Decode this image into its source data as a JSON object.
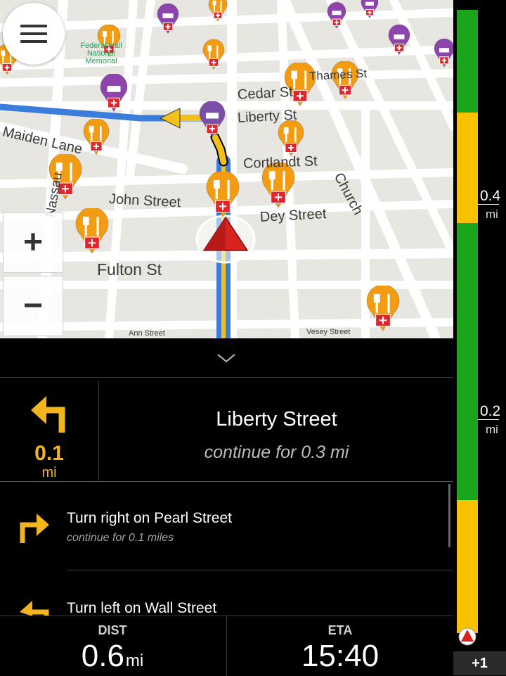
{
  "map": {
    "streets": {
      "maiden_lane": "Maiden Lane",
      "john_street": "John Street",
      "fulton_st": "Fulton St",
      "nassau": "Nassau",
      "cedar_st": "Cedar St",
      "liberty_st": "Liberty St",
      "cortlandt_st": "Cortlandt St",
      "dey_street": "Dey Street",
      "church": "Church",
      "thames_st": "Thames St",
      "ann_street": "Ann Street",
      "vesey_street": "Vesey Street"
    },
    "landmark": "Federal Hall National Memorial",
    "colors": {
      "route": "#3b7ddd",
      "route_center": "#f2c21b",
      "poi_food": "#f39c12",
      "poi_hotel": "#8e44ad",
      "position_arrow": "#d9231f"
    }
  },
  "controls": {
    "zoom_in": "+",
    "zoom_out": "−"
  },
  "progress": {
    "label_04": "0.4",
    "label_02": "0.2",
    "unit": "mi",
    "end_badge": "+1",
    "colors": {
      "green": "#1ba51b",
      "yellow": "#f8c200"
    }
  },
  "current": {
    "distance": "0.1",
    "distance_unit": "mi",
    "street": "Liberty Street",
    "continue": "continue for 0.3 mi"
  },
  "steps": [
    {
      "title": "Turn right on Pearl Street",
      "subtitle": "continue for 0.1 miles"
    },
    {
      "title": "Turn left on Wall Street"
    }
  ],
  "footer": {
    "dist_label": "DIST",
    "dist_value": "0.6",
    "dist_unit": "mi",
    "eta_label": "ETA",
    "eta_value": "15:40"
  }
}
